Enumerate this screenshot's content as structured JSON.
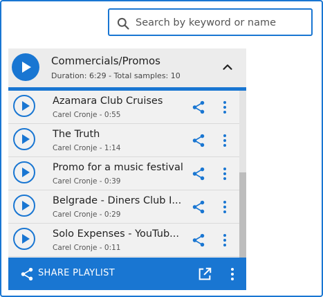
{
  "search": {
    "placeholder": "Search by keyword or name",
    "icon": "search-icon"
  },
  "playlist": {
    "title": "Commercials/Promos",
    "meta": "Duration: 6:29 - Total samples: 10",
    "collapse_icon": "chevron-up-icon"
  },
  "tracks": [
    {
      "title": "Azamara Club Cruises",
      "meta": "Carel Cronje - 0:55"
    },
    {
      "title": "The Truth",
      "meta": "Carel Cronje - 1:14"
    },
    {
      "title": "Promo for a music festival",
      "meta": "Carel Cronje - 0:39"
    },
    {
      "title": "Belgrade - Diners Club I...",
      "meta": "Carel Cronje - 0:29"
    },
    {
      "title": "Solo Expenses - YouTub...",
      "meta": "Carel Cronje - 0:11"
    }
  ],
  "footer": {
    "share_label": "SHARE PLAYLIST",
    "icons": [
      "share-icon",
      "open-in-new-icon",
      "more-vertical-icon"
    ]
  },
  "colors": {
    "accent": "#1976d2",
    "row_bg": "#f1f1f1",
    "header_bg": "#ececec"
  }
}
